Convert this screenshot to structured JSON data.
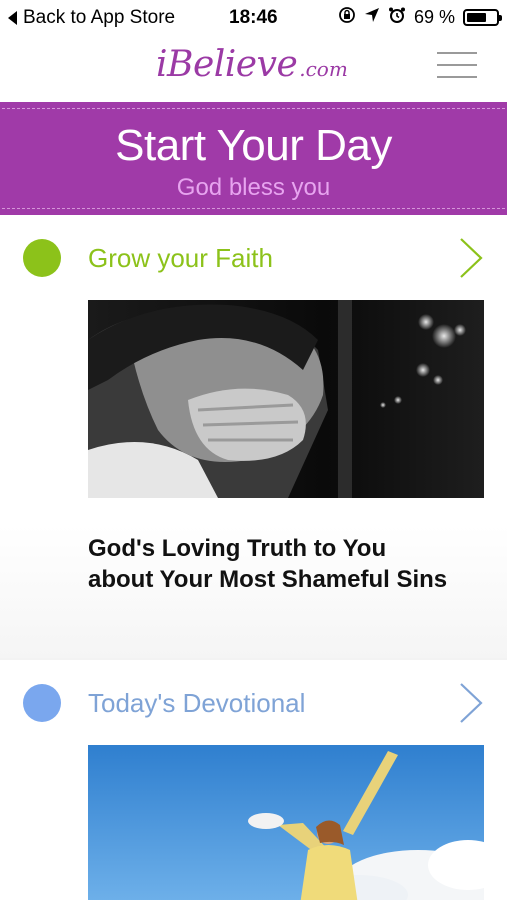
{
  "status_bar": {
    "back_label": "Back to App Store",
    "time": "18:46",
    "battery_text": "69 %",
    "battery_level": 0.69,
    "icons": [
      "screen-rotation-lock-icon",
      "location-arrow-icon",
      "alarm-icon",
      "battery-icon"
    ]
  },
  "header": {
    "logo_main": "iBelieve",
    "logo_tld": ".com",
    "menu_icon": "hamburger-menu-icon"
  },
  "banner": {
    "title": "Start Your Day",
    "subtitle": "God bless you"
  },
  "sections": [
    {
      "title": "Grow your Faith",
      "dot_color": "#8cc21a",
      "title_color": "#8cc21a",
      "headline_line1": "God's Loving Truth to You",
      "headline_line2": "about Your Most Shameful Sins",
      "image": "woman-covering-face-photo"
    },
    {
      "title": "Today's Devotional",
      "dot_color": "#7aa7ee",
      "title_color": "#7fa3d6",
      "image": "woman-arms-raised-sky-photo"
    }
  ],
  "colors": {
    "brand_purple": "#a03aa8",
    "banner_subtitle": "#e7a4ef",
    "logo": "#9b3aa5"
  }
}
